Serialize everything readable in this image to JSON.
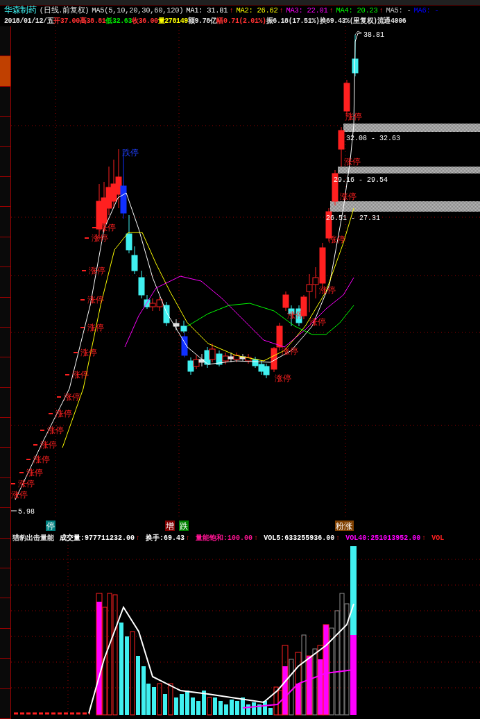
{
  "header": {
    "stock_name": "华森制药",
    "period": "(日线.前复权)",
    "ma_params": "MA5(5,10,20,30,60,120)",
    "ma_values": [
      {
        "label": "MA1:",
        "value": "31.81",
        "color": "#ffffff",
        "arrow": "↑"
      },
      {
        "label": "MA2:",
        "value": "26.62",
        "color": "#ffff00",
        "arrow": "↑"
      },
      {
        "label": "MA3:",
        "value": "22.01",
        "color": "#ff00ff",
        "arrow": "↑"
      },
      {
        "label": "MA4:",
        "value": "20.23",
        "color": "#00ff00",
        "arrow": "↑"
      },
      {
        "label": "MA5:",
        "value": "-",
        "color": "#c0c0c0"
      },
      {
        "label": "MA6:",
        "value": "-",
        "color": "#0000ff"
      }
    ]
  },
  "quote": {
    "date": "2018/01/12/五",
    "fields": [
      {
        "text": "开37.00",
        "color": "#ff3232"
      },
      {
        "text": "高38.81",
        "color": "#ff3232"
      },
      {
        "text": "低32.63",
        "color": "#00e600"
      },
      {
        "text": "收36.00",
        "color": "#ff3232"
      },
      {
        "text": "量278149",
        "color": "#ffff00"
      },
      {
        "text": "额9.78亿",
        "color": "#e0e0e0"
      },
      {
        "text": "幅0.71(2.01%)",
        "color": "#ff3232"
      },
      {
        "text": "振6.18(17.51%)",
        "color": "#e0e0e0"
      },
      {
        "text": "换69.43%(里复权)",
        "color": "#e0e0e0"
      },
      {
        "text": "流通4006",
        "color": "#e0e0e0"
      }
    ]
  },
  "price_chart": {
    "high_label": "38.81",
    "low_label": "5.98",
    "zones": [
      "32.08 - 32.63",
      "29.16 - 29.54",
      "26.51 - 27.31"
    ],
    "limit_marks": [
      {
        "text": "涨停",
        "kind": "up"
      },
      {
        "text": "涨停",
        "kind": "up"
      },
      {
        "text": "涨停",
        "kind": "up"
      },
      {
        "text": "涨停",
        "kind": "up"
      },
      {
        "text": "涨停",
        "kind": "up"
      },
      {
        "text": "涨停",
        "kind": "up"
      },
      {
        "text": "涨停",
        "kind": "up"
      },
      {
        "text": "涨停",
        "kind": "up"
      },
      {
        "text": "涨停",
        "kind": "up"
      },
      {
        "text": "涨停",
        "kind": "up"
      },
      {
        "text": "涨停",
        "kind": "up"
      },
      {
        "text": "涨停",
        "kind": "up"
      },
      {
        "text": "涨停",
        "kind": "up"
      },
      {
        "text": "涨停",
        "kind": "up"
      },
      {
        "text": "涨停",
        "kind": "up"
      },
      {
        "text": "跌停",
        "kind": "down"
      },
      {
        "text": "涨停",
        "kind": "up"
      },
      {
        "text": "涨停",
        "kind": "up"
      },
      {
        "text": "涨停",
        "kind": "up"
      },
      {
        "text": "涨停",
        "kind": "up"
      },
      {
        "text": "涨停",
        "kind": "up"
      },
      {
        "text": "涨停",
        "kind": "up"
      },
      {
        "text": "涨停",
        "kind": "up"
      },
      {
        "text": "涨停",
        "kind": "up"
      },
      {
        "text": "涨停",
        "kind": "up"
      }
    ]
  },
  "event_badges": [
    {
      "text": "停",
      "color": "#008080"
    },
    {
      "text": "增",
      "color": "#800000"
    },
    {
      "text": "跌",
      "color": "#008000"
    },
    {
      "text": "粉涨",
      "color": "#804000"
    }
  ],
  "volume": {
    "indicator": "猎豹出击量能",
    "items": [
      {
        "label": "成交量:",
        "value": "977711232.00",
        "color": "#ffffff",
        "arrow": "↑"
      },
      {
        "label": "换手:",
        "value": "69.43",
        "color": "#ffffff",
        "arrow": "↑"
      },
      {
        "label": "量能饱和:",
        "value": "100.00",
        "color": "#ff1493",
        "arrow": "↑"
      },
      {
        "label": "VOL5:",
        "value": "633255936.00",
        "color": "#ffffff",
        "arrow": "↑"
      },
      {
        "label": "VOL40:",
        "value": "251013952.00",
        "color": "#ff00ff",
        "arrow": "↑"
      },
      {
        "label": "VOL",
        "value": "",
        "color": "#ff2020"
      }
    ]
  }
}
